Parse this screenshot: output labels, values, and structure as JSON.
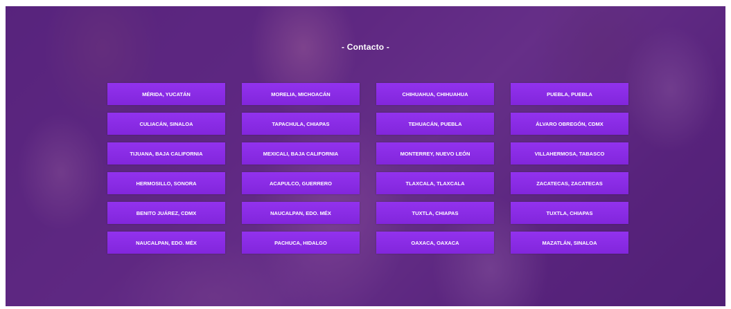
{
  "section": {
    "title": "- Contacto -"
  },
  "colors": {
    "button": "#8a2be2",
    "overlay": "#6226a0",
    "text": "#ffffff"
  },
  "locations": [
    [
      "MÉRIDA, YUCATÁN",
      "MORELIA, MICHOACÁN",
      "CHIHUAHUA, CHIHUAHUA",
      "PUEBLA, PUEBLA"
    ],
    [
      "CULIACÁN, SINALOA",
      "TAPACHULA, CHIAPAS",
      "TEHUACÁN, PUEBLA",
      "ÁLVARO OBREGÓN, CDMX"
    ],
    [
      "TIJUANA, BAJA CALIFORNIA",
      "MEXICALI, BAJA CALIFORNIA",
      "MONTERREY, NUEVO LEÓN",
      "VILLAHERMOSA, TABASCO"
    ],
    [
      "HERMOSILLO, SONORA",
      "ACAPULCO, GUERRERO",
      "TLAXCALA, TLAXCALA",
      "ZACATECAS, ZACATECAS"
    ],
    [
      "BENITO JUÁREZ, CDMX",
      "NAUCALPAN, EDO. MÉX",
      "TUXTLA, CHIAPAS",
      "TUXTLA, CHIAPAS"
    ],
    [
      "NAUCALPAN, EDO. MÉX",
      "PACHUCA, HIDALGO",
      "OAXACA, OAXACA",
      "MAZATLÁN, SINALOA"
    ]
  ]
}
